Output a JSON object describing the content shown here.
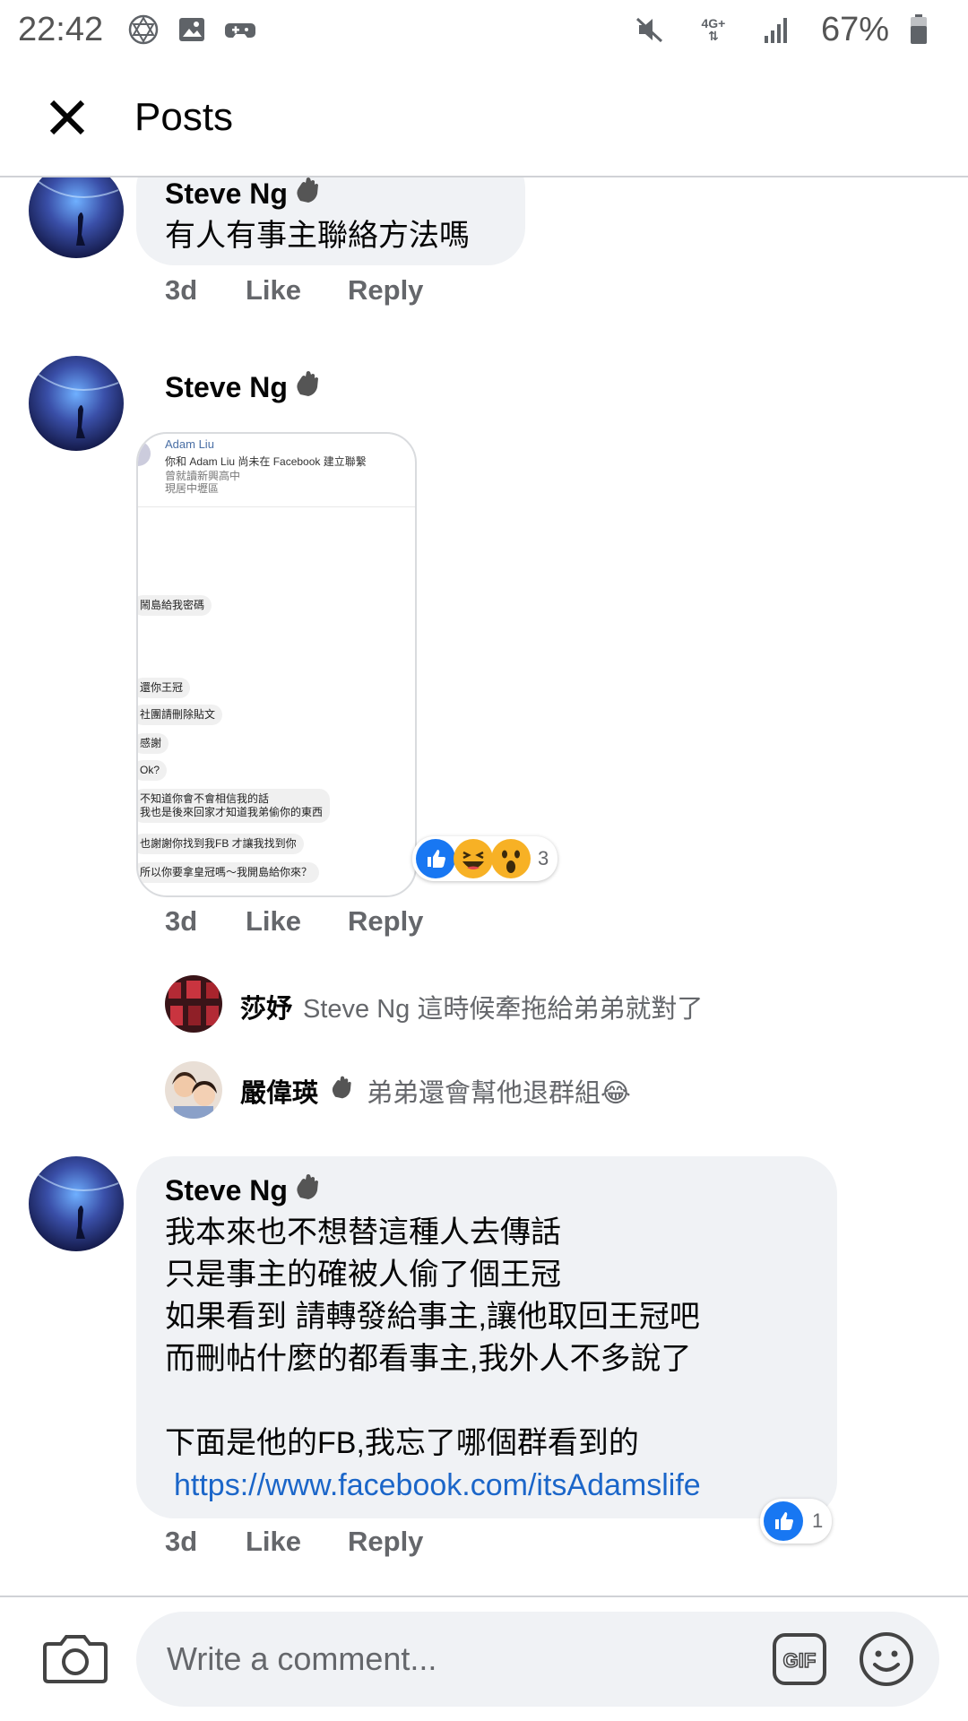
{
  "status_bar": {
    "time": "22:42",
    "battery": "67%",
    "network": "4G+"
  },
  "header": {
    "title": "Posts"
  },
  "comments": [
    {
      "author": "Steve Ng",
      "text": "有人有事主聯絡方法嗎",
      "time": "3d",
      "like": "Like",
      "reply": "Reply"
    },
    {
      "author": "Steve Ng",
      "time": "3d",
      "like": "Like",
      "reply": "Reply",
      "reaction_count": "3",
      "image": {
        "name": "Adam Liu",
        "lines": [
          "你和 Adam Liu 尚未在 Facebook 建立聯繫",
          "曾就讀新興高中",
          "現居中壢區"
        ],
        "messages": [
          "鬧島給我密碼",
          "還你王冠",
          "社團請刪除貼文",
          "感謝",
          "Ok?",
          "不知道你會不會相信我的話\n我也是後來回家才知道我弟偷你的東西",
          "也謝謝你找到我FB 才讓我找到你",
          "所以你要拿皇冠嗎～我開島給你來？"
        ]
      },
      "replies": [
        {
          "author": "莎妤",
          "text": "Steve Ng 這時候牽拖給弟弟就對了"
        },
        {
          "author": "嚴偉瑛",
          "text": "弟弟還會幫他退群組😂"
        }
      ]
    },
    {
      "author": "Steve Ng",
      "text": "我本來也不想替這種人去傳話\n只是事主的確被人偷了個王冠\n如果看到 請轉發給事主,讓他取回王冠吧\n而刪帖什麼的都看事主,我外人不多說了\n\n下面是他的FB,我忘了哪個群看到的",
      "link": "https://www.facebook.com/itsAdamslife",
      "time": "3d",
      "like": "Like",
      "reply": "Reply",
      "reaction_count": "1"
    }
  ],
  "composer": {
    "placeholder": "Write a comment..."
  },
  "colors": {
    "bubble": "#f0f2f5",
    "link": "#1b66c9",
    "like_blue": "#1877f2",
    "muted": "#65676b"
  }
}
